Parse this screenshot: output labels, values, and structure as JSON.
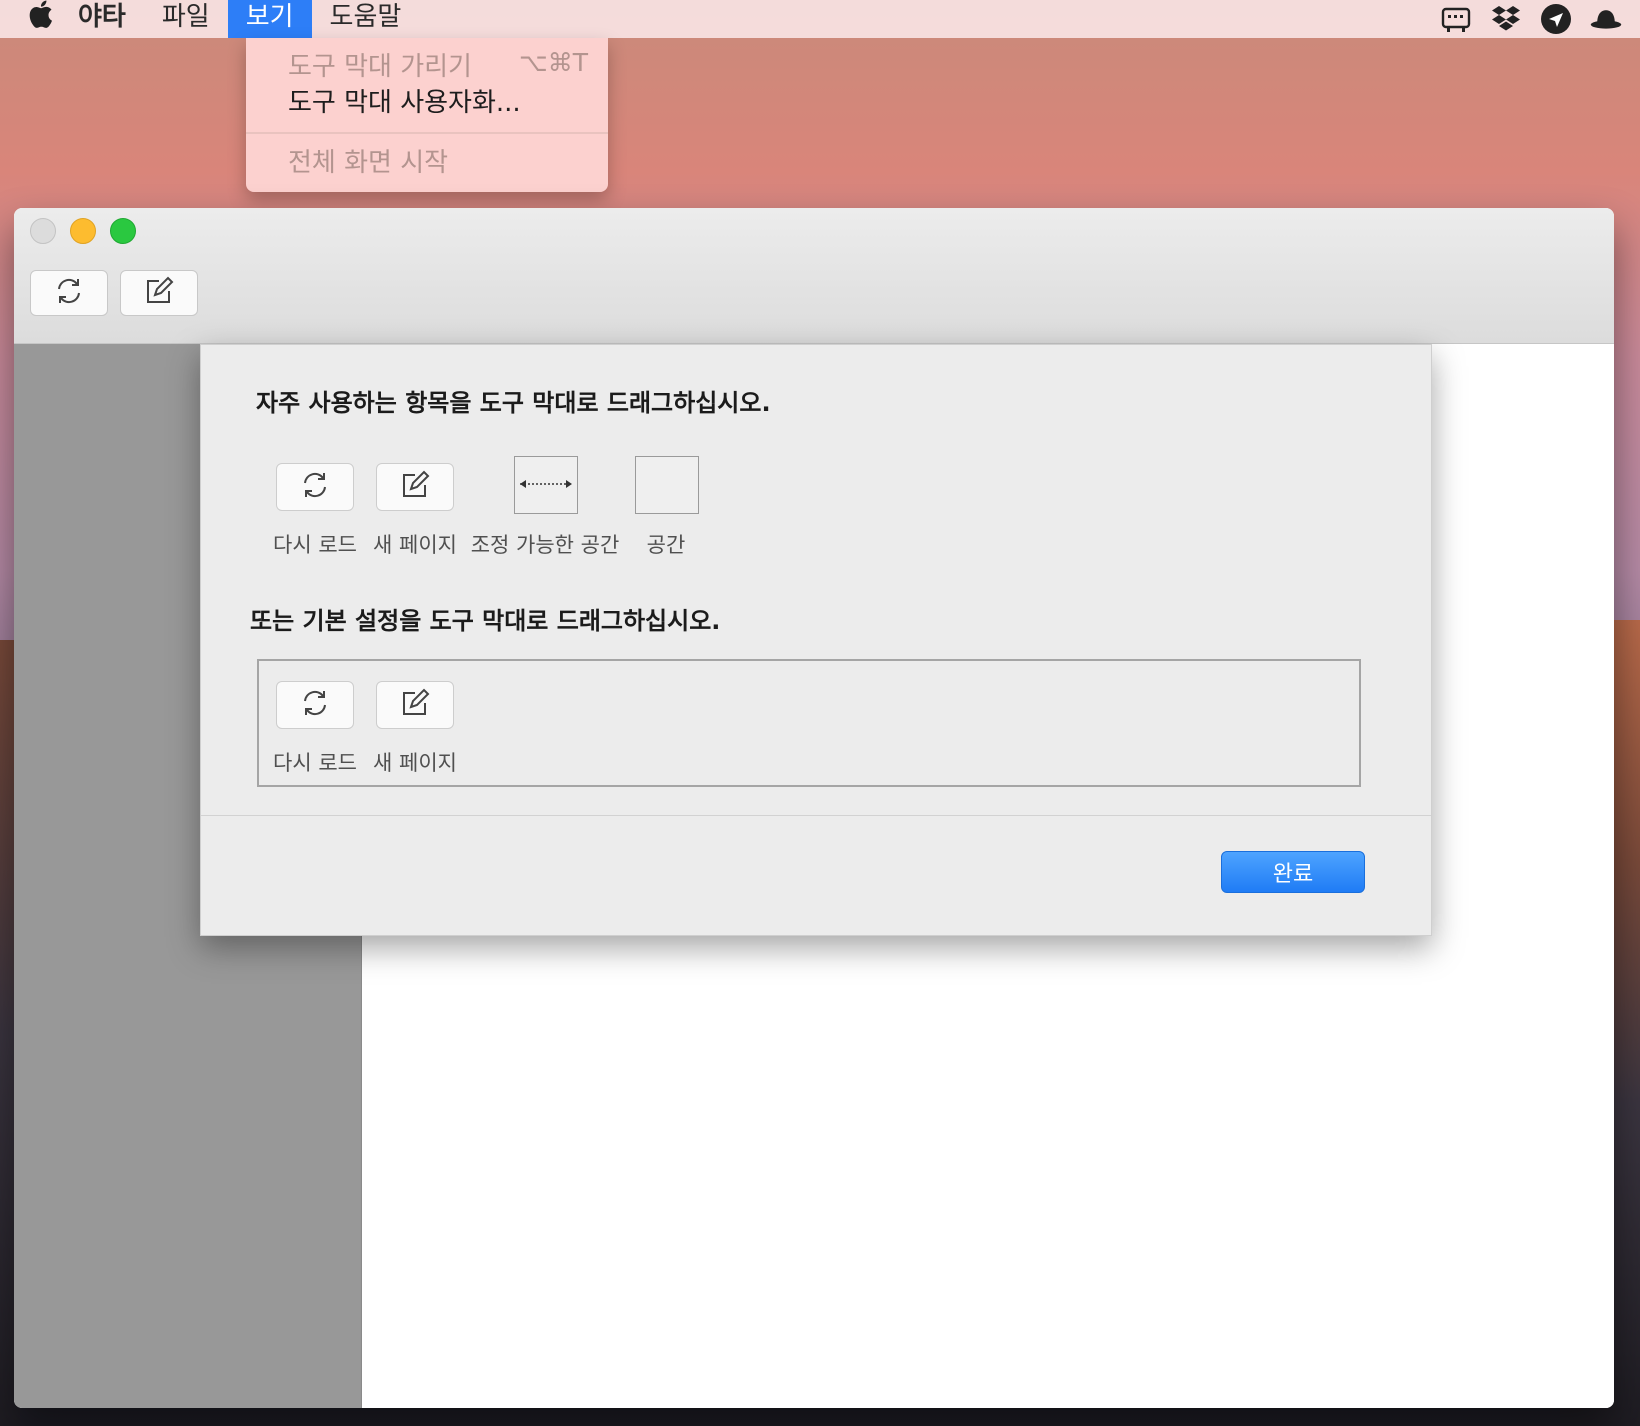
{
  "menubar": {
    "items": [
      {
        "label": "야타",
        "bold": true
      },
      {
        "label": "파일"
      },
      {
        "label": "보기",
        "active": true
      },
      {
        "label": "도움말"
      }
    ],
    "status_icons": [
      "keyboard-icon",
      "dropbox-icon",
      "location-arrow-icon",
      "bowler-hat-icon"
    ]
  },
  "dropdown": {
    "items": [
      {
        "label": "도구 막대 가리기",
        "shortcut": "⌥⌘T",
        "enabled": false
      },
      {
        "label": "도구 막대 사용자화...",
        "enabled": true
      },
      {
        "label": "전체 화면 시작",
        "enabled": false
      }
    ]
  },
  "toolbar": {
    "buttons": [
      {
        "name": "reload",
        "icon": "reload-icon"
      },
      {
        "name": "new-page",
        "icon": "compose-icon"
      }
    ]
  },
  "sheet": {
    "heading_items": "자주 사용하는 항목을 도구 막대로 드래그하십시오.",
    "items": [
      {
        "label": "다시 로드",
        "icon": "reload-icon"
      },
      {
        "label": "새 페이지",
        "icon": "compose-icon"
      },
      {
        "label": "조정 가능한 공간",
        "icon": "flexible-space-icon"
      },
      {
        "label": "공간",
        "icon": "space-icon"
      }
    ],
    "heading_default": "또는 기본 설정을 도구 막대로 드래그하십시오.",
    "default_items": [
      {
        "label": "다시 로드",
        "icon": "reload-icon"
      },
      {
        "label": "새 페이지",
        "icon": "compose-icon"
      }
    ],
    "done_label": "완료"
  },
  "colors": {
    "accent": "#2d7ef7",
    "menubar_bg": "#f8e2e2",
    "dropdown_bg": "#fdd4d2",
    "sidebar_bg": "#989898"
  }
}
